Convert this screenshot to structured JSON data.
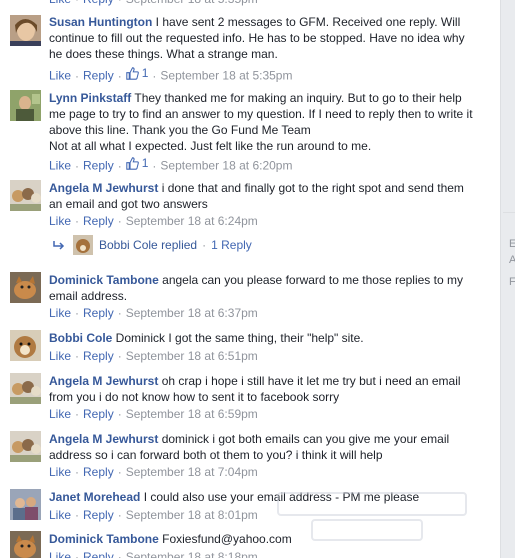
{
  "actions": {
    "like": "Like",
    "reply": "Reply",
    "separator": "·"
  },
  "top_partial": {
    "text": "Like · Reply · September 18 at 5:35pm"
  },
  "comments": [
    {
      "name": "Susan Huntington",
      "text": "I have sent 2 messages to GFM. Received one reply. Will continue to fill out the requested info. He has to be stopped. Have no idea why he does these things. What a strange man.",
      "likes": "1",
      "time": "September 18 at 5:35pm"
    },
    {
      "name": "Lynn Pinkstaff",
      "text": "They thanked me for making an inquiry. But to go to their help me page to try to find an answer to my question. If I need to reply then to write it above this line. Thank you the Go Fund Me Team",
      "text2": "Not at all what I expected. Just felt like the run around to me.",
      "likes": "1",
      "time": "September 18 at 6:20pm"
    },
    {
      "name": "Angela M Jewhurst",
      "text": "i done that and finally got to the right spot and send them an email and got two answers",
      "time": "September 18 at 6:24pm"
    },
    {
      "name": "Dominick Tambone",
      "text": "angela can you please forward to me those replies to my email address.",
      "time": "September 18 at 6:37pm"
    },
    {
      "name": "Bobbi Cole",
      "text": "Dominick I got the same thing, their \"help\" site.",
      "time": "September 18 at 6:51pm"
    },
    {
      "name": "Angela M Jewhurst",
      "text": "oh crap i hope i still have it let me try but i need an email from you i do not know how to sent it to facebook sorry",
      "time": "September 18 at 6:59pm"
    },
    {
      "name": "Angela M Jewhurst",
      "text": "dominick i got both emails can you give me your email address so i can forward both ot them to you? i think it will help",
      "time": "September 18 at 7:04pm"
    },
    {
      "name": "Janet Morehead",
      "text": "I could also use your email address - PM me please",
      "time": "September 18 at 8:01pm"
    },
    {
      "name": "Dominick Tambone",
      "text": "Foxiesfund@yahoo.com",
      "time": "September 18 at 8:18pm"
    }
  ],
  "reply_summary": {
    "name": "Bobbi Cole",
    "action": "replied",
    "count": "1 Reply"
  },
  "sidebar": {
    "letters": [
      "E",
      "A",
      "F"
    ]
  },
  "icons": {
    "like": "thumbs-up-icon",
    "reply_arrow": "reply-arrow-icon"
  },
  "colors": {
    "name": "#365899",
    "link": "#4267b2",
    "meta": "#90949c",
    "text": "#1d2129"
  }
}
